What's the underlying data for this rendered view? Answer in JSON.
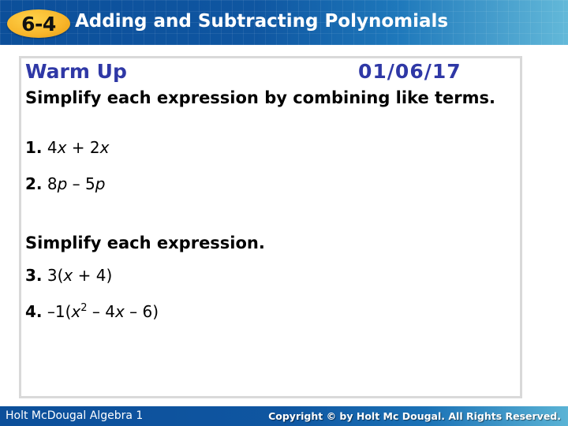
{
  "header": {
    "lesson_number": "6-4",
    "title": "Adding and Subtracting Polynomials"
  },
  "warmup": {
    "title": "Warm Up",
    "date": "01/06/17",
    "instruction_1": "Simplify each expression by combining like terms.",
    "instruction_2": "Simplify each expression.",
    "problems": [
      {
        "number": "1.",
        "parts": [
          {
            "t": "4"
          },
          {
            "t": "x",
            "i": true
          },
          {
            "t": " + 2"
          },
          {
            "t": "x",
            "i": true
          }
        ]
      },
      {
        "number": "2.",
        "parts": [
          {
            "t": "8"
          },
          {
            "t": "p",
            "i": true
          },
          {
            "t": " – 5"
          },
          {
            "t": "p",
            "i": true
          }
        ]
      },
      {
        "number": "3.",
        "parts": [
          {
            "t": "3("
          },
          {
            "t": "x",
            "i": true
          },
          {
            "t": " + 4)"
          }
        ]
      },
      {
        "number": "4.",
        "parts": [
          {
            "t": "–1("
          },
          {
            "t": "x",
            "i": true
          },
          {
            "t": "2",
            "sup": true
          },
          {
            "t": " – 4"
          },
          {
            "t": "x",
            "i": true
          },
          {
            "t": " – 6)"
          }
        ]
      }
    ]
  },
  "footer": {
    "left": "Holt McDougal Algebra 1",
    "right": "Copyright © by Holt Mc Dougal. All Rights Reserved."
  },
  "colors": {
    "header_blue": "#0f56a1",
    "badge_orange": "#f7b52a",
    "heading_blue": "#2f38a6",
    "panel_border": "#d9d9d9"
  }
}
